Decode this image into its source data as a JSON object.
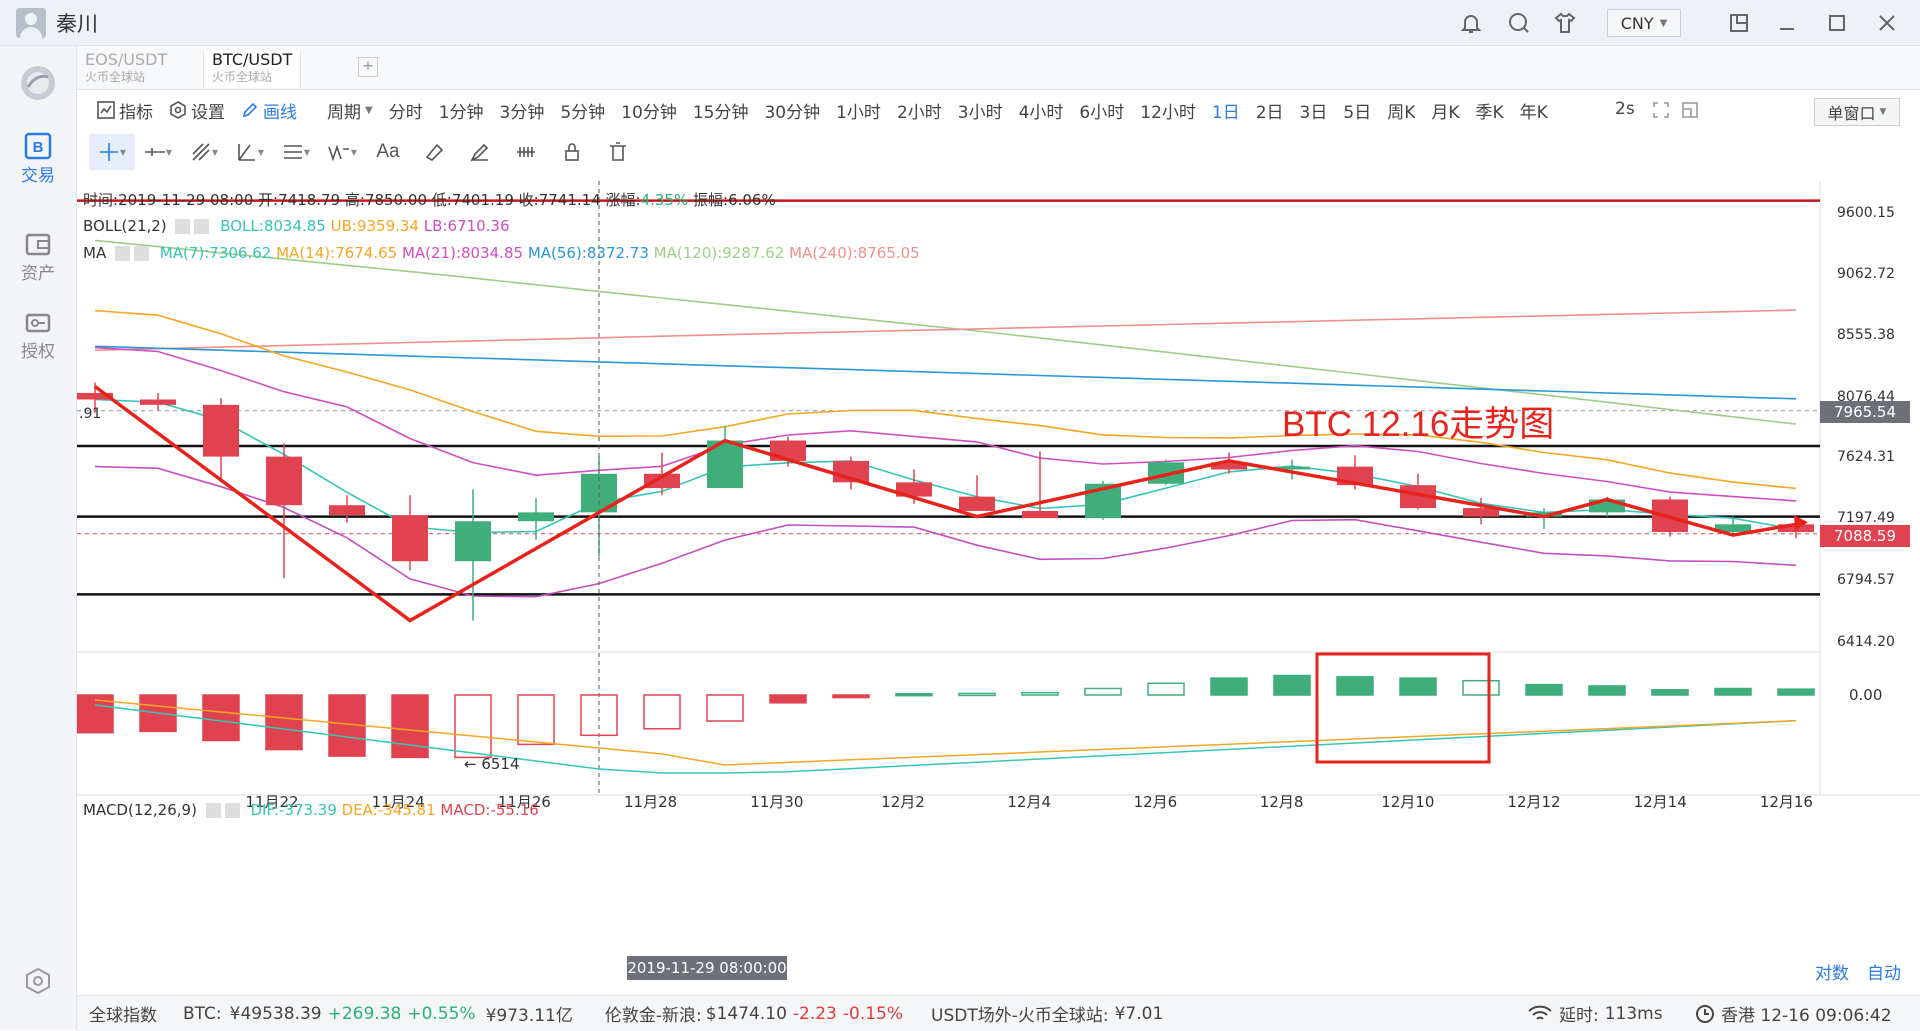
{
  "app": {
    "user_name": "秦川",
    "currency": "CNY"
  },
  "sidebar": {
    "items": [
      {
        "label": "交易",
        "icon": "trade-icon",
        "active": true
      },
      {
        "label": "资产",
        "icon": "wallet-icon",
        "active": false
      },
      {
        "label": "授权",
        "icon": "key-icon",
        "active": false
      }
    ]
  },
  "tabs": [
    {
      "pair": "EOS/USDT",
      "exchange": "火币全球站",
      "active": false
    },
    {
      "pair": "BTC/USDT",
      "exchange": "火币全球站",
      "active": true
    }
  ],
  "toolbar": {
    "indicator": "指标",
    "settings": "设置",
    "draw": "画线",
    "period": "周期",
    "periods": [
      "分时",
      "1分钟",
      "3分钟",
      "5分钟",
      "10分钟",
      "15分钟",
      "30分钟",
      "1小时",
      "2小时",
      "3小时",
      "4小时",
      "6小时",
      "12小时",
      "1日",
      "2日",
      "3日",
      "5日",
      "周K",
      "月K",
      "季K",
      "年K"
    ],
    "selected_period": "1日",
    "refresh": "2s",
    "window_mode": "单窗口"
  },
  "drawing_tools": [
    "crosshair-tool-icon",
    "horizontal-line-tool-icon",
    "trend-line-tool-icon",
    "angle-tool-icon",
    "parallel-channel-tool-icon",
    "wave-tool-icon",
    "text-tool-icon",
    "eraser-tool-icon",
    "brush-tool-icon",
    "measure-tool-icon",
    "lock-icon",
    "trash-icon"
  ],
  "info": {
    "ohlc": {
      "time_label": "时间:",
      "time": "2019-11-29 08:00",
      "open_label": "开:",
      "open": "7418.79",
      "high_label": "高:",
      "high": "7850.00",
      "low_label": "低:",
      "low": "7401.19",
      "close_label": "收:",
      "close": "7741.14",
      "chg_label": "涨幅:",
      "chg": "4.35%",
      "amp_label": "振幅:",
      "amp": "6.06%"
    },
    "boll": {
      "name": "BOLL(21,2)",
      "boll": "BOLL:8034.85",
      "ub": "UB:9359.34",
      "lb": "LB:6710.36"
    },
    "ma": {
      "name": "MA",
      "ma7": "MA(7):7306.62",
      "ma14": "MA(14):7674.65",
      "ma21": "MA(21):8034.85",
      "ma56": "MA(56):8372.73",
      "ma120": "MA(120):9287.62",
      "ma240": "MA(240):8765.05"
    },
    "macd": {
      "name": "MACD(12,26,9)",
      "dif": "DIF:-373.39",
      "dea": "DEA:-345.81",
      "macd": "MACD:-55.16"
    }
  },
  "annotation": {
    "title": "BTC 12.16走势图",
    "low_mark": "← 6514",
    "left_cut_label": ".91"
  },
  "colors": {
    "up": "#3fae7a",
    "down": "#e0434f",
    "ma7": "#35c5b5",
    "ma14": "#f5a623",
    "ma21": "#d04fc0",
    "ma56": "#2b96d6",
    "ma120": "#9ccf86",
    "ma240": "#f0908e",
    "arrow": "#e8231c",
    "resist": "#c4161c"
  },
  "chart_data": {
    "type": "candlestick",
    "dates": [
      "11-21",
      "11-22",
      "11-23",
      "11-24",
      "11-25",
      "11-26",
      "11-27",
      "11-28",
      "11-29",
      "11-30",
      "12-01",
      "12-02",
      "12-03",
      "12-04",
      "12-05",
      "12-06",
      "12-07",
      "12-08",
      "12-09",
      "12-10",
      "12-11",
      "12-12",
      "12-13",
      "12-14",
      "12-15",
      "12-16"
    ],
    "ohlc": [
      [
        8100,
        8180,
        7950,
        8050
      ],
      [
        8050,
        8100,
        7970,
        8010
      ],
      [
        8010,
        8060,
        7450,
        7620
      ],
      [
        7620,
        7720,
        6800,
        7280
      ],
      [
        7280,
        7350,
        7160,
        7210
      ],
      [
        7210,
        7350,
        6850,
        6910
      ],
      [
        6910,
        7390,
        6540,
        7170
      ],
      [
        7170,
        7330,
        7050,
        7230
      ],
      [
        7230,
        7620,
        6940,
        7500
      ],
      [
        7500,
        7650,
        7350,
        7400
      ],
      [
        7400,
        7850,
        7401,
        7741
      ],
      [
        7741,
        7770,
        7550,
        7590
      ],
      [
        7590,
        7620,
        7390,
        7440
      ],
      [
        7440,
        7530,
        7290,
        7340
      ],
      [
        7340,
        7490,
        7250,
        7240
      ],
      [
        7240,
        7660,
        7200,
        7190
      ],
      [
        7190,
        7450,
        7180,
        7430
      ],
      [
        7430,
        7600,
        7420,
        7580
      ],
      [
        7580,
        7650,
        7500,
        7530
      ],
      [
        7530,
        7600,
        7460,
        7550
      ],
      [
        7550,
        7630,
        7390,
        7420
      ],
      [
        7420,
        7500,
        7250,
        7260
      ],
      [
        7260,
        7330,
        7150,
        7200
      ],
      [
        7200,
        7260,
        7120,
        7230
      ],
      [
        7230,
        7340,
        7200,
        7320
      ],
      [
        7320,
        7340,
        7070,
        7100
      ],
      [
        7100,
        7200,
        7080,
        7150
      ],
      [
        7150,
        7170,
        7060,
        7100
      ]
    ],
    "y_ticks": [
      "9600.15",
      "9062.72",
      "8555.38",
      "8076.44",
      "7624.31",
      "7197.49",
      "6794.57",
      "6414.20"
    ],
    "x_ticks": [
      "11月22",
      "11月24",
      "11月26",
      "11月28",
      "11月30",
      "12月2",
      "12月4",
      "12月6",
      "12月8",
      "12月10",
      "12月12",
      "12月14",
      "12月16"
    ],
    "crosshair_date": "2019-11-29 08:00:00",
    "price_tags": {
      "current": "7088.59",
      "level": "7965.54"
    },
    "macd_zero": "0.00",
    "macd_hist": [
      -290,
      -280,
      -350,
      -420,
      -470,
      -480,
      -480,
      -380,
      -310,
      -260,
      -200,
      -60,
      -20,
      10,
      12,
      18,
      50,
      90,
      130,
      150,
      140,
      130,
      110,
      80,
      70,
      40,
      50,
      45
    ],
    "horizontal_levels": [
      9700,
      7700,
      7200,
      6700
    ]
  },
  "bottom_right": {
    "log": "对数",
    "auto": "自动"
  },
  "footer": {
    "index_label": "全球指数",
    "btc_label": "BTC:",
    "btc_price": "¥49538.39",
    "btc_chg": "+269.38",
    "btc_pct": "+0.55%",
    "btc_vol": "¥973.11亿",
    "gold_label": "伦敦金-新浪:",
    "gold_price": "$1474.10",
    "gold_chg": "-2.23",
    "gold_pct": "-0.15%",
    "usdt_label": "USDT场外-火币全球站:",
    "usdt_price": "¥7.01",
    "latency_label": "延时:",
    "latency": "113ms",
    "clock": "香港 12-16 09:06:42"
  }
}
